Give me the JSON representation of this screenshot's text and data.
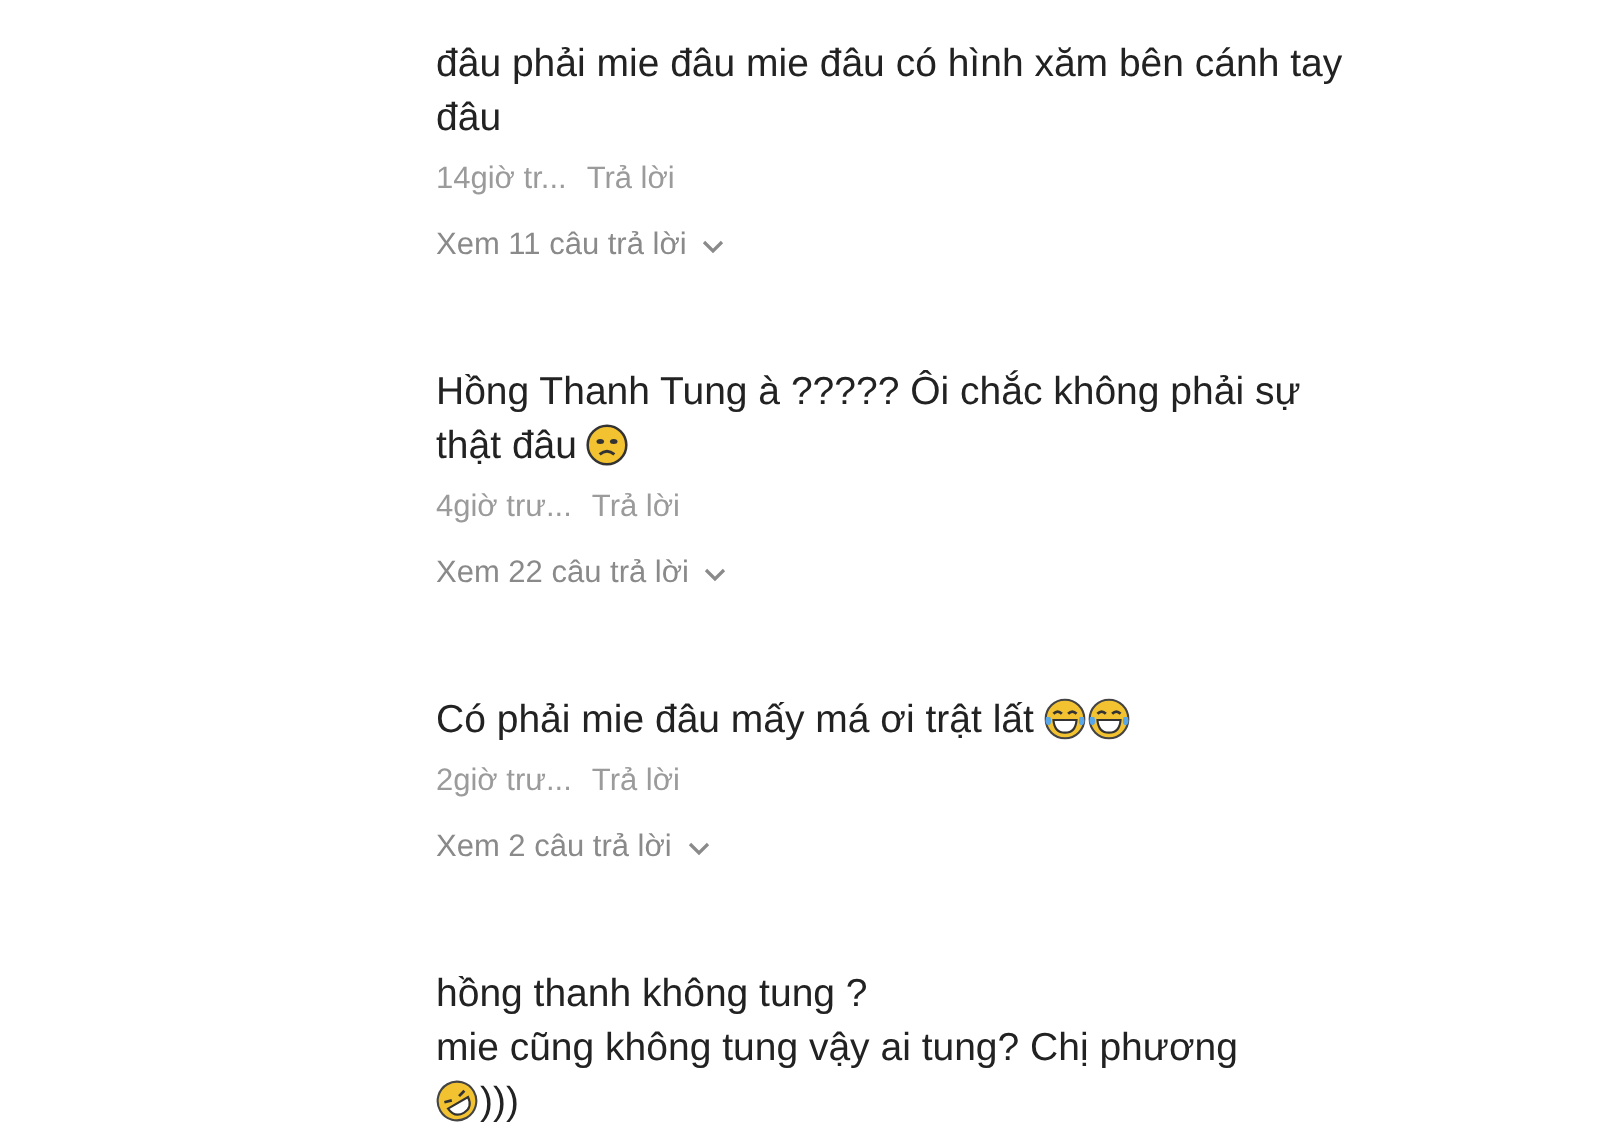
{
  "comments": [
    {
      "lines": [
        [
          {
            "kind": "text",
            "text": "đâu phải mie đâu mie đâu có hình xăm bên cánh tay đâu"
          }
        ]
      ],
      "time": "14giờ tr...",
      "reply": "Trả lời",
      "view_replies": "Xem 11 câu trả lời"
    },
    {
      "lines": [
        [
          {
            "kind": "text",
            "text": "Hồng Thanh Tung à ????? Ôi chắc không phải sự"
          }
        ],
        [
          {
            "kind": "text",
            "text": "thật đâu"
          },
          {
            "kind": "sad"
          }
        ]
      ],
      "time": "4giờ trư...",
      "reply": "Trả lời",
      "view_replies": "Xem 22 câu trả lời"
    },
    {
      "lines": [
        [
          {
            "kind": "text",
            "text": "Có phải mie đâu mấy má ơi trật lất"
          },
          {
            "kind": "laugh"
          },
          {
            "kind": "laugh"
          }
        ]
      ],
      "time": "2giờ trư...",
      "reply": "Trả lời",
      "view_replies": "Xem 2 câu trả lời"
    },
    {
      "lines": [
        [
          {
            "kind": "text",
            "text": "hồng thanh không tung ?"
          }
        ],
        [
          {
            "kind": "text",
            "text": "mie cũng không tung vậy ai tung? Chị phương"
          }
        ],
        [
          {
            "kind": "rofl"
          },
          {
            "kind": "text",
            "text": ")))"
          }
        ]
      ]
    }
  ]
}
